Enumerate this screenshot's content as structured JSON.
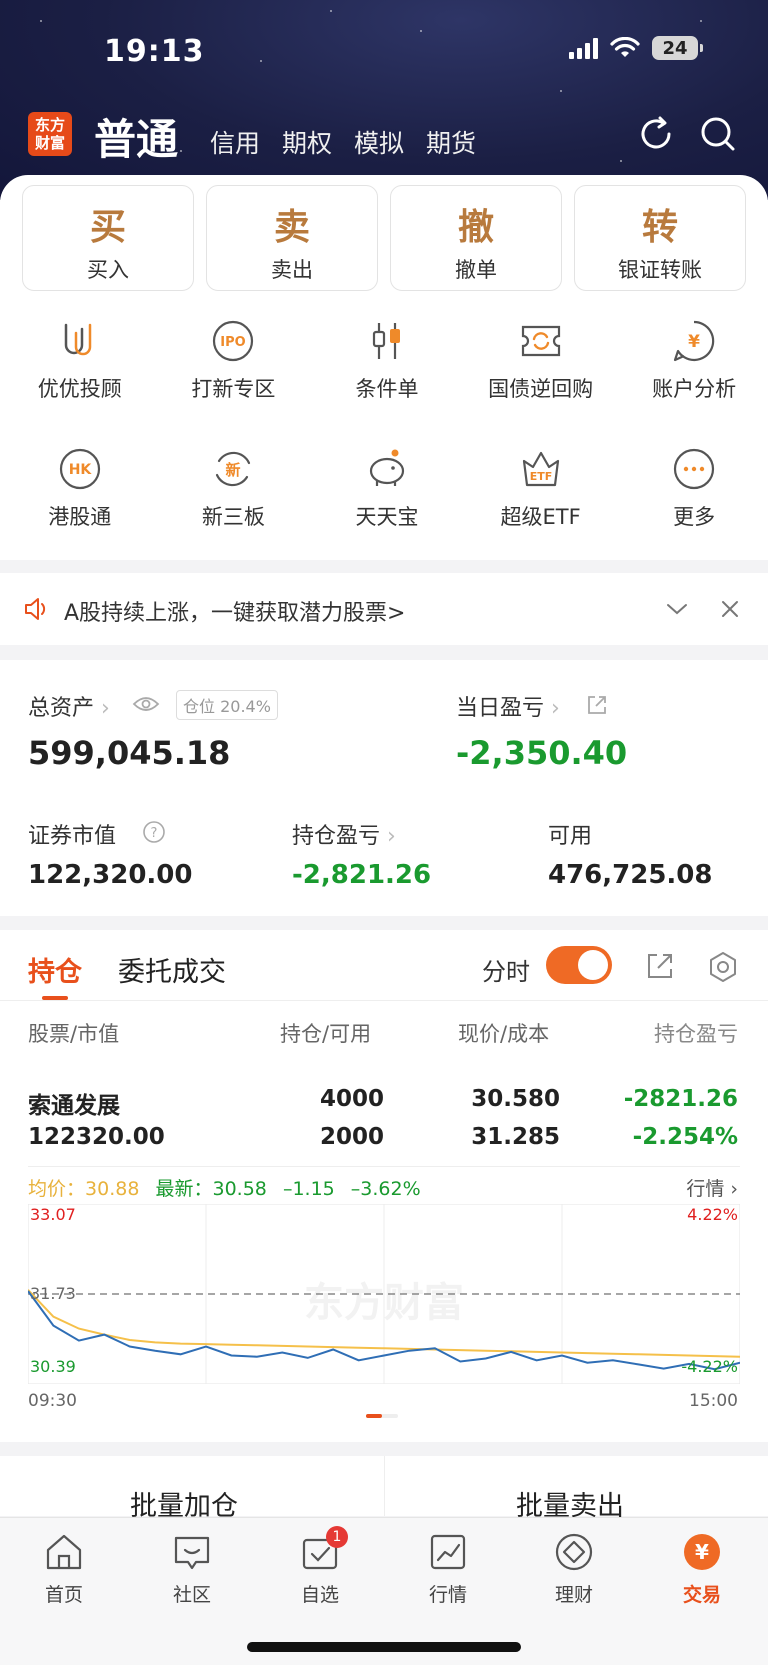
{
  "status_bar": {
    "time": "19:13",
    "battery": "24"
  },
  "header": {
    "logo": [
      "东方",
      "财富"
    ],
    "active_tab": "普通",
    "tabs": [
      "信用",
      "期权",
      "模拟",
      "期货"
    ]
  },
  "quick_actions": [
    {
      "char": "买",
      "label": "买入"
    },
    {
      "char": "卖",
      "label": "卖出"
    },
    {
      "char": "撤",
      "label": "撤单"
    },
    {
      "char": "转",
      "label": "银证转账"
    }
  ],
  "features": [
    {
      "label": "优优投顾",
      "icon": "uu-advisor-icon"
    },
    {
      "label": "打新专区",
      "icon": "ipo-icon",
      "icon_text": "IPO"
    },
    {
      "label": "条件单",
      "icon": "candlestick-icon"
    },
    {
      "label": "国债逆回购",
      "icon": "bond-repo-icon"
    },
    {
      "label": "账户分析",
      "icon": "account-analysis-icon",
      "icon_text": "¥"
    },
    {
      "label": "港股通",
      "icon": "hk-icon",
      "icon_text": "HK"
    },
    {
      "label": "新三板",
      "icon": "new-board-icon",
      "icon_text": "新"
    },
    {
      "label": "天天宝",
      "icon": "piggy-bank-icon"
    },
    {
      "label": "超级ETF",
      "icon": "etf-icon",
      "icon_text": "ETF"
    },
    {
      "label": "更多",
      "icon": "more-icon",
      "icon_text": "···"
    }
  ],
  "banner": {
    "text": "A股持续上涨，一键获取潜力股票>"
  },
  "assets": {
    "total_label": "总资产",
    "position_badge": "仓位 20.4%",
    "total_value": "599,045.18",
    "daily_pl_label": "当日盈亏",
    "daily_pl_value": "-2,350.40",
    "market_value_label": "证券市值",
    "market_value": "122,320.00",
    "holding_pl_label": "持仓盈亏",
    "holding_pl_value": "-2,821.26",
    "available_label": "可用",
    "available_value": "476,725.08"
  },
  "positions": {
    "tab_active": "持仓",
    "tab_other": "委托成交",
    "toggle_label": "分时",
    "headers": [
      "股票/市值",
      "持仓/可用",
      "现价/成本",
      "持仓盈亏"
    ],
    "row": {
      "name": "索通发展",
      "market_value": "122320.00",
      "holding": "4000",
      "available": "2000",
      "price": "30.580",
      "cost": "31.285",
      "pl": "-2821.26",
      "pl_pct": "-2.254%"
    },
    "quote": {
      "avg_label": "均价：",
      "avg_value": "30.88",
      "latest_label": "最新：",
      "latest_value": "30.58",
      "change": "–1.15",
      "change_pct": "–3.62%",
      "link": "行情"
    }
  },
  "chart_data": {
    "type": "line",
    "y_top_label": "33.07",
    "y_mid_label": "31.73",
    "y_bottom_label": "30.39",
    "pct_top_label": "4.22%",
    "pct_bottom_label": "-4.22%",
    "x_start": "09:30",
    "x_end": "15:00",
    "watermark": "东方财富",
    "ylim": [
      30.39,
      33.07
    ],
    "reference": 31.73,
    "series": [
      {
        "values": [
          31.8,
          31.35,
          31.15,
          31.05,
          30.96,
          30.92,
          30.9,
          30.89,
          30.88,
          30.87,
          30.86,
          30.85,
          30.84,
          30.83,
          30.82,
          30.81,
          30.8,
          30.79,
          30.78,
          30.77,
          30.76,
          30.75,
          30.74,
          30.73,
          30.72,
          30.71,
          30.7,
          30.69,
          30.68
        ]
      },
      {
        "values": [
          31.78,
          31.2,
          30.95,
          31.05,
          30.85,
          30.78,
          30.72,
          30.85,
          30.7,
          30.68,
          30.75,
          30.66,
          30.8,
          30.62,
          30.7,
          30.78,
          30.82,
          30.6,
          30.65,
          30.76,
          30.62,
          30.7,
          30.58,
          30.62,
          30.55,
          30.48,
          30.56,
          30.47,
          30.58
        ]
      }
    ]
  },
  "batch_actions": [
    "批量加仓",
    "批量卖出"
  ],
  "tab_bar": [
    {
      "label": "首页",
      "icon": "home-icon"
    },
    {
      "label": "社区",
      "icon": "community-icon"
    },
    {
      "label": "自选",
      "icon": "watchlist-icon",
      "badge": "1"
    },
    {
      "label": "行情",
      "icon": "market-icon"
    },
    {
      "label": "理财",
      "icon": "wealth-icon"
    },
    {
      "label": "交易",
      "icon": "trade-icon",
      "active": true
    }
  ],
  "colors": {
    "brand": "#e8501c",
    "gold": "#b87a3d",
    "down": "#1a9a2f",
    "up": "#e02020",
    "avg_line": "#f5c04a",
    "price_line": "#2f6eb5"
  }
}
